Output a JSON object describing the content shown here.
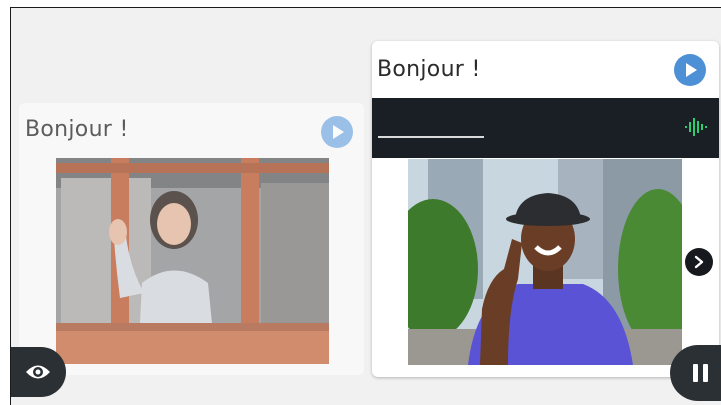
{
  "cards": [
    {
      "title": "Bonjour !",
      "play_icon": "play-icon",
      "image": "woman-waving-at-window-photo",
      "state": "previous"
    },
    {
      "title": "Bonjour !",
      "play_icon": "play-icon",
      "answer": {
        "value": "",
        "mic_icon": "voice-waveform-icon",
        "accent": "#2ecc71"
      },
      "image": "man-in-hat-tipping-brim-photo",
      "state": "active"
    }
  ],
  "controls": {
    "next_icon": "chevron-right-icon",
    "eye_icon": "eye-icon",
    "pause_icon": "pause-icon"
  },
  "colors": {
    "play_blue": "#4d90d6",
    "answer_bar": "#1a1f26",
    "control_dark": "#2b3035"
  }
}
